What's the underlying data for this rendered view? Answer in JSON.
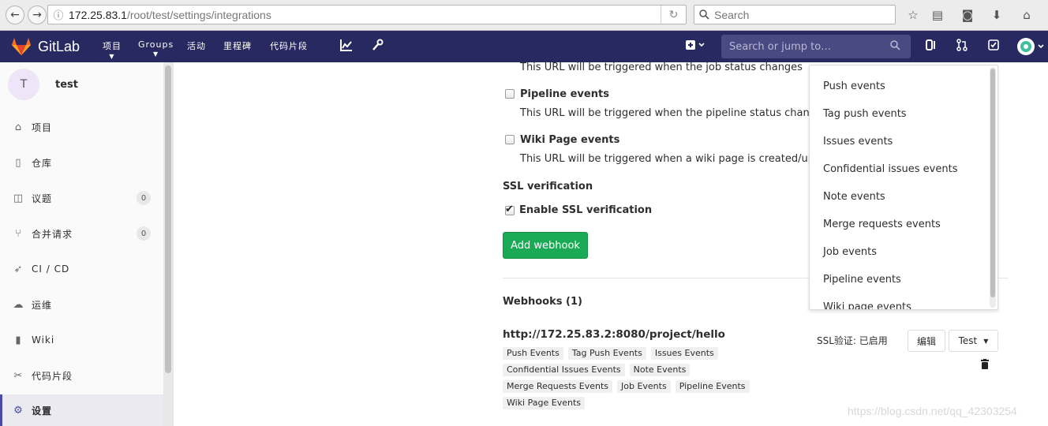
{
  "browser": {
    "url_host": "172.25.83.1",
    "url_path": "/root/test/settings/integrations",
    "search_placeholder": "Search"
  },
  "gitlab_nav": {
    "brand": "GitLab",
    "menu": [
      "项目",
      "Groups",
      "活动",
      "里程碑",
      "代码片段"
    ],
    "search_placeholder": "Search or jump to…"
  },
  "sidebar": {
    "avatar_letter": "T",
    "project_name": "test",
    "items": [
      {
        "label": "项目",
        "icon": "home-icon"
      },
      {
        "label": "仓库",
        "icon": "file-icon"
      },
      {
        "label": "议题",
        "icon": "issues-icon",
        "count": "0"
      },
      {
        "label": "合并请求",
        "icon": "merge-request-icon",
        "count": "0"
      },
      {
        "label": "CI / CD",
        "icon": "rocket-icon"
      },
      {
        "label": "运维",
        "icon": "cloud-gear-icon"
      },
      {
        "label": "Wiki",
        "icon": "book-icon"
      },
      {
        "label": "代码片段",
        "icon": "scissors-icon"
      },
      {
        "label": "设置",
        "icon": "gear-icon",
        "active": true
      }
    ]
  },
  "form": {
    "job_desc": "This URL will be triggered when the job status changes",
    "pipeline_label": "Pipeline events",
    "pipeline_desc": "This URL will be triggered when the pipeline status changes",
    "wiki_label": "Wiki Page events",
    "wiki_desc": "This URL will be triggered when a wiki page is created/updated",
    "ssl_heading": "SSL verification",
    "ssl_checkbox_label": "Enable SSL verification",
    "ssl_checked": true,
    "add_button": "Add webhook"
  },
  "webhooks": {
    "heading": "Webhooks (1)",
    "url": "http://172.25.83.2:8080/project/hello",
    "tags": [
      "Push Events",
      "Tag Push Events",
      "Issues Events",
      "Confidential Issues Events",
      "Note Events",
      "Merge Requests Events",
      "Job Events",
      "Pipeline Events",
      "Wiki Page Events"
    ],
    "ssl_status": "SSL验证: 已启用",
    "edit_button": "编辑",
    "test_button": "Test"
  },
  "test_dropdown": {
    "items": [
      "Push events",
      "Tag push events",
      "Issues events",
      "Confidential issues events",
      "Note events",
      "Merge requests events",
      "Job events",
      "Pipeline events",
      "Wiki page events"
    ]
  },
  "watermark": "https://blog.csdn.net/qq_42303254",
  "colors": {
    "gitlab_nav": "#292961",
    "add_button": "#1aaa55",
    "sidebar_active": "#4b4ba3"
  }
}
